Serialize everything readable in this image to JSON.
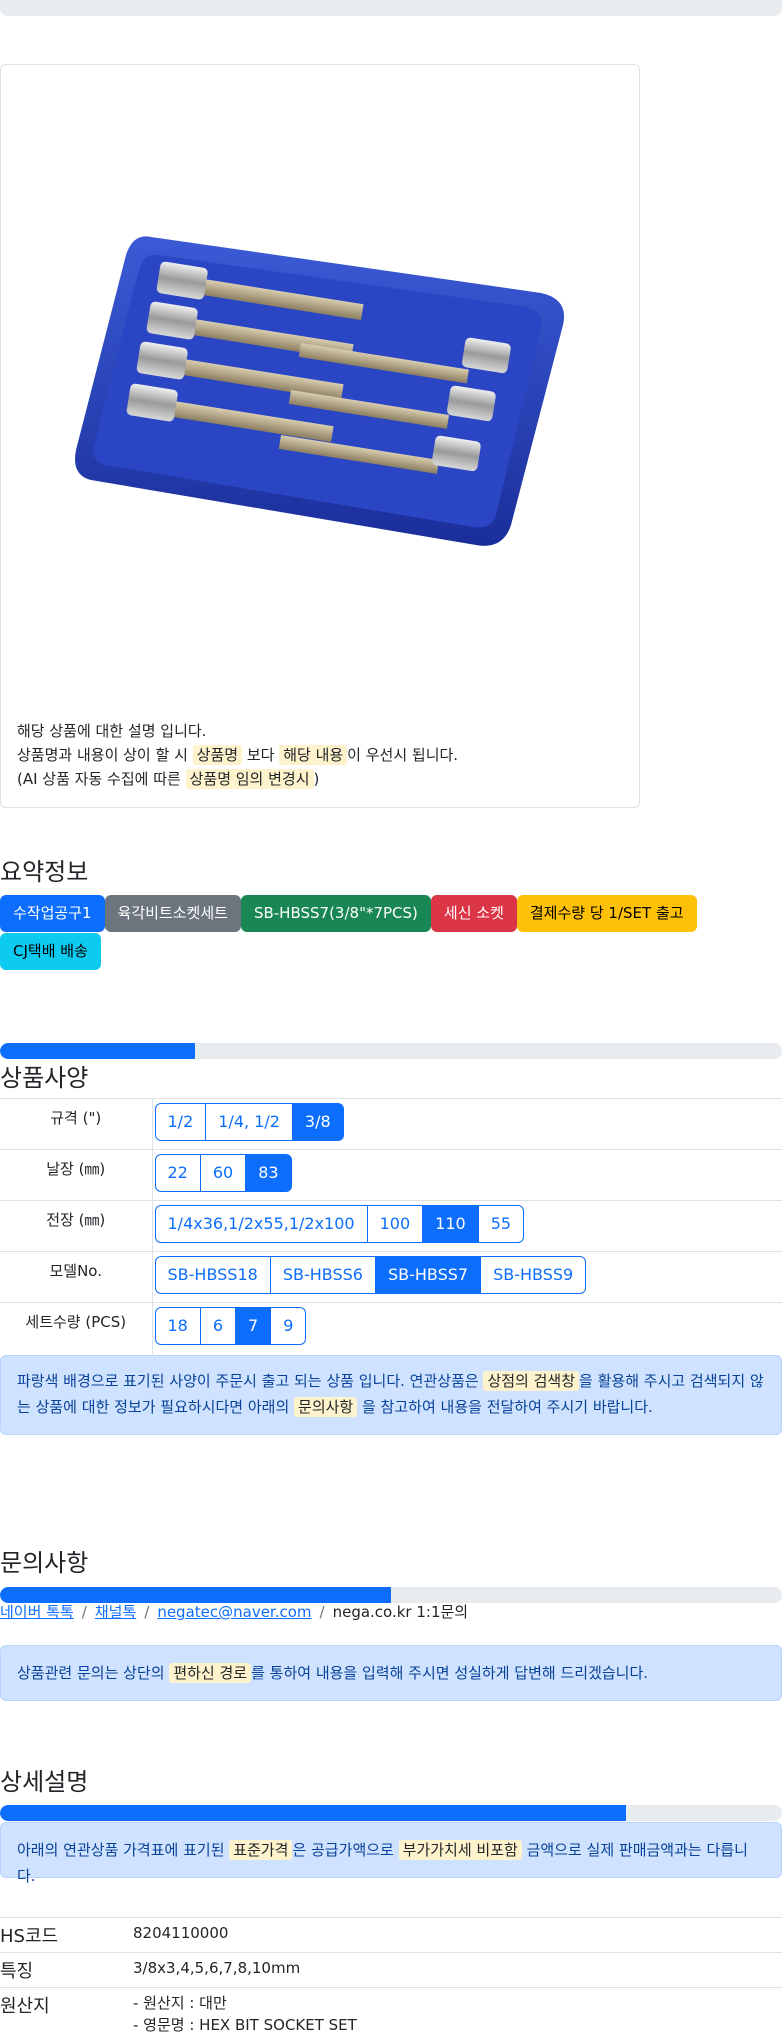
{
  "notes": {
    "line1": "해당 상품에 대한 설명 입니다.",
    "line2_a": "상품명과 내용이 상이 할 시 ",
    "line2_hl1": "상품명",
    "line2_b": " 보다 ",
    "line2_hl2": "해당 내용",
    "line2_c": "이 우선시 됩니다.",
    "line3_a": "(AI 상품 자동 수집에 따른 ",
    "line3_hl": "상품명 임의 변경시",
    "line3_b": ")"
  },
  "summary": {
    "title": "요약정보",
    "badges": [
      "수작업공구1",
      "육각비트소켓세트",
      "SB-HBSS7(3/8\"*7PCS)",
      "세신 소켓",
      "결제수량 당 1/SET 출고",
      "CJ택배 배송"
    ]
  },
  "spec": {
    "title": "상품사양",
    "progress_pct": 25,
    "rows": [
      {
        "label": "규격 (\")",
        "options": [
          "1/2",
          "1/4, 1/2",
          "3/8"
        ],
        "selected": "3/8"
      },
      {
        "label": "날장 (㎜)",
        "options": [
          "22",
          "60",
          "83"
        ],
        "selected": "83"
      },
      {
        "label": "전장 (㎜)",
        "options": [
          "1/4x36,1/2x55,1/2x100",
          "100",
          "110",
          "55"
        ],
        "selected": "110"
      },
      {
        "label": "모델No.",
        "options": [
          "SB-HBSS18",
          "SB-HBSS6",
          "SB-HBSS7",
          "SB-HBSS9"
        ],
        "selected": "SB-HBSS7"
      },
      {
        "label": "세트수량 (PCS)",
        "options": [
          "18",
          "6",
          "7",
          "9"
        ],
        "selected": "7"
      }
    ],
    "alert_a": "파랑색 배경으로 표기된 사양이 주문시 출고 되는 상품 입니다. 연관상품은 ",
    "alert_hl1": "상점의 검색창",
    "alert_b": "을 활용해 주시고 검색되지 않는 상품에 대한 정보가 필요하시다면 아래의 ",
    "alert_hl2": "문의사항",
    "alert_c": " 을 참고하여 내용을 전달하여 주시기 바랍니다."
  },
  "inquiry": {
    "title": "문의사항",
    "progress_pct": 50,
    "crumbs": [
      "네이버 톡톡",
      "채널톡",
      "negatec@naver.com"
    ],
    "current": "nega.co.kr 1:1문의",
    "alert_a": "상품관련 문의는 상단의 ",
    "alert_hl": "편하신 경로",
    "alert_b": "를 통하여 내용을 입력해 주시면 성실하게 답변해 드리겠습니다."
  },
  "detail": {
    "title": "상세설명",
    "progress_pct": 80,
    "alert_a": "아래의 연관상품 가격표에 표기된 ",
    "alert_hl1": "표준가격",
    "alert_b": "은 공급가액으로 ",
    "alert_hl2": "부가가치세 비포함",
    "alert_c": " 금액으로 실제 판매금액과는 다릅니다.",
    "rows": [
      {
        "key": "HS코드",
        "values": [
          "8204110000"
        ]
      },
      {
        "key": "특징",
        "values": [
          "3/8x3,4,5,6,7,8,10mm"
        ]
      },
      {
        "key": "원산지",
        "values": [
          "- 원산지 : 대만",
          "- 영문명 : HEX BIT SOCKET SET"
        ]
      }
    ]
  },
  "colors": {
    "primary": "#0d6efd",
    "highlight": "#fff3cd",
    "alert_bg": "#cfe2ff"
  }
}
